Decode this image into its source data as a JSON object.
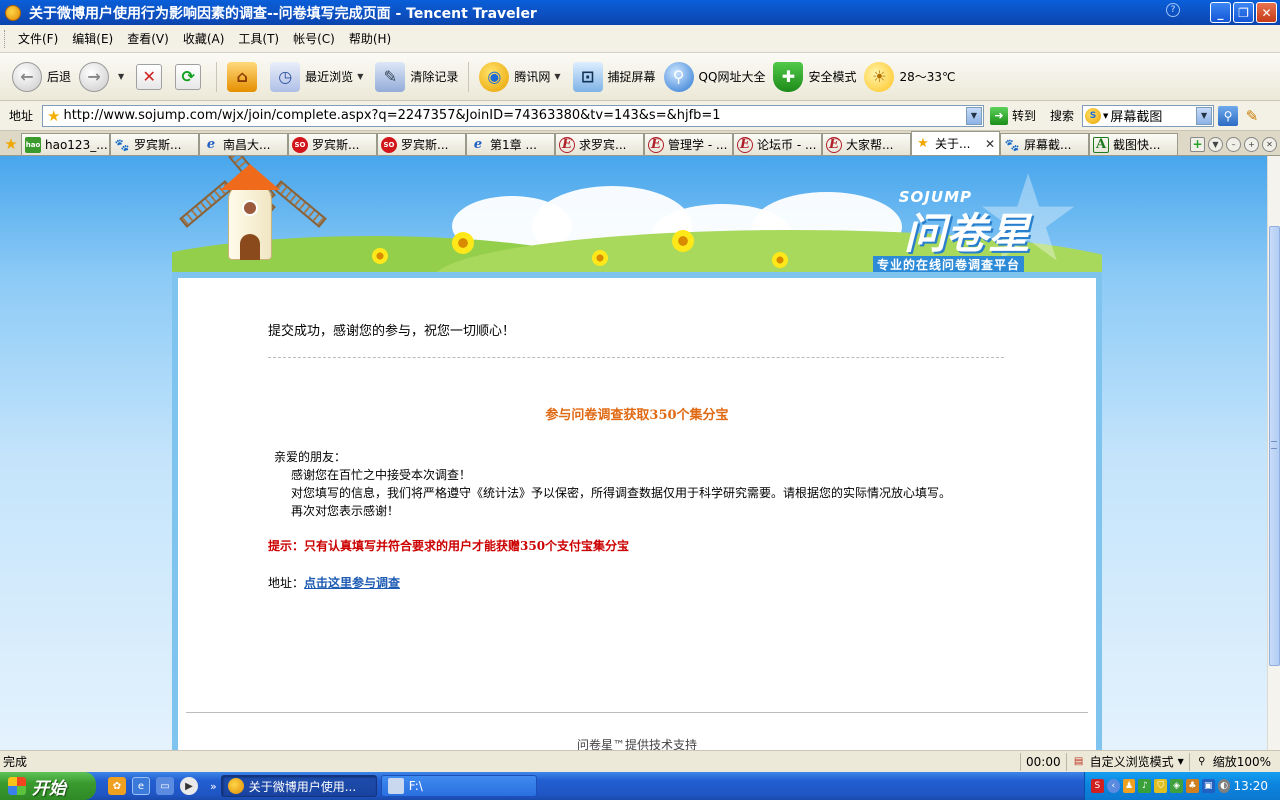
{
  "window": {
    "title": "关于微博用户使用行为影响因素的调查--问卷填写完成页面 - Tencent Traveler",
    "controls": {
      "minimize": "_",
      "maximize": "❐",
      "close": "✕"
    }
  },
  "menu": [
    "文件(F)",
    "编辑(E)",
    "查看(V)",
    "收藏(A)",
    "工具(T)",
    "帐号(C)",
    "帮助(H)"
  ],
  "toolbar": {
    "back": "后退",
    "recent": "最近浏览",
    "clear": "清除记录",
    "tencent": "腾讯网",
    "capture": "捕捉屏幕",
    "qq_sites": "QQ网址大全",
    "safe_mode": "安全模式",
    "weather": "28～33℃"
  },
  "address": {
    "label": "地址",
    "url": "http://www.sojump.com/wjx/join/complete.aspx?q=2247357&JoinID=74363380&tv=143&s=&hjfb=1",
    "go": "转到",
    "search_label": "搜索",
    "search_value": "屏幕截图"
  },
  "tabs": [
    {
      "label": "hao123_...",
      "icon": "hao",
      "icon_text": "hao"
    },
    {
      "label": "罗宾斯...",
      "icon": "paw",
      "icon_text": "🐾"
    },
    {
      "label": "南昌大...",
      "icon": "ie",
      "icon_text": "e"
    },
    {
      "label": "罗宾斯...",
      "icon": "so",
      "icon_text": "SO"
    },
    {
      "label": "罗宾斯...",
      "icon": "so",
      "icon_text": "SO"
    },
    {
      "label": "第1章  ...",
      "icon": "ie",
      "icon_text": "e"
    },
    {
      "label": "求罗宾...",
      "icon": "e",
      "icon_text": "E"
    },
    {
      "label": "管理学 - ...",
      "icon": "e",
      "icon_text": "E"
    },
    {
      "label": "论坛币 - ...",
      "icon": "e",
      "icon_text": "E"
    },
    {
      "label": "大家帮...",
      "icon": "e",
      "icon_text": "E"
    },
    {
      "label": "关于...",
      "icon": "star",
      "icon_text": "★",
      "active": true
    },
    {
      "label": "屏幕截...",
      "icon": "paw",
      "icon_text": "🐾"
    },
    {
      "label": "截图快...",
      "icon": "a",
      "icon_text": "A"
    }
  ],
  "banner": {
    "logo_en": "SOJUMP",
    "logo_cn": "问卷星",
    "logo_sub": "专业的在线问卷调查平台"
  },
  "content": {
    "success": "提交成功，感谢您的参与，祝您一切顺心！",
    "headline": "参与问卷调查获取350个集分宝",
    "greeting": "亲爱的朋友：",
    "line1": "感谢您在百忙之中接受本次调查！",
    "line2": "对您填写的信息，我们将严格遵守《统计法》予以保密，所得调查数据仅用于科学研究需要。请根据您的实际情况放心填写。",
    "line3": "再次对您表示感谢！",
    "tip": "提示：只有认真填写并符合要求的用户才能获赠350个支付宝集分宝",
    "addr_label": "地址：",
    "addr_link": "点击这里参与调查",
    "footer": "问卷星™提供技术支持"
  },
  "status": {
    "text": "完成",
    "time": "00:00",
    "mode": "自定义浏览模式",
    "zoom": "缩放100%"
  },
  "taskbar": {
    "start": "开始",
    "tasks": [
      "关于微博用户使用...",
      "F:\\"
    ],
    "clock": "13:20"
  }
}
